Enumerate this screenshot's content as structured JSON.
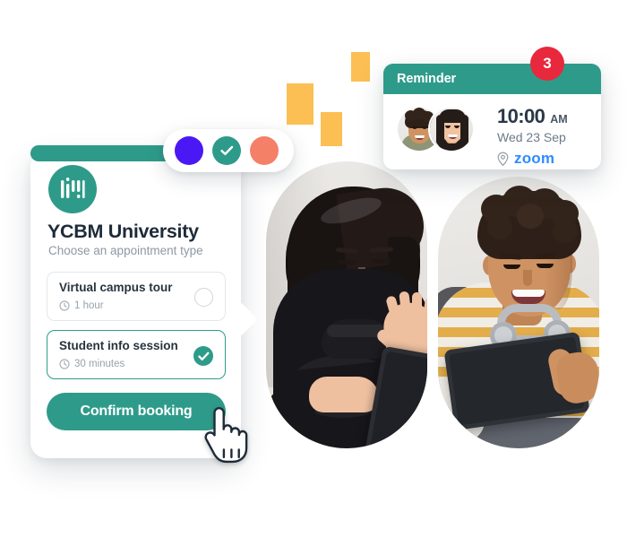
{
  "booking_card": {
    "brand_logo_icon": "ycbm-bars-logo-icon",
    "title": "YCBM University",
    "subtitle": "Choose an appointment type",
    "options": [
      {
        "name": "Virtual campus tour",
        "duration": "1 hour",
        "duration_icon": "clock-icon",
        "selected": false,
        "control_icon": "radio-empty-icon"
      },
      {
        "name": "Student info session",
        "duration": "30 minutes",
        "duration_icon": "clock-icon",
        "selected": true,
        "control_icon": "check-circle-icon"
      }
    ],
    "confirm_label": "Confirm booking",
    "accent_color": "#2E9B8A"
  },
  "color_picker": {
    "swatches": [
      {
        "name": "purple",
        "color": "#4A18F5",
        "selected": false
      },
      {
        "name": "teal",
        "color": "#2E9B8A",
        "selected": true,
        "icon": "check-icon"
      },
      {
        "name": "coral",
        "color": "#F58068",
        "selected": false
      }
    ]
  },
  "reminder_card": {
    "header_title": "Reminder",
    "header_color": "#2E9B8A",
    "attendees": [
      {
        "name": "attendee-1",
        "avatar_icon": "avatar-man"
      },
      {
        "name": "attendee-2",
        "avatar_icon": "avatar-woman"
      }
    ],
    "time": "10:00",
    "meridiem": "AM",
    "date": "Wed 23 Sep",
    "location_icon": "map-pin-icon",
    "location": "zoom",
    "location_color": "#2D8CFF",
    "badge_count": "3",
    "badge_color": "#E8283C"
  },
  "photos": [
    {
      "name": "woman-waving-at-tablet"
    },
    {
      "name": "man-with-headphones-holding-tablet"
    }
  ],
  "decorations": {
    "sparkles": [
      {
        "name": "sparkle-large",
        "color": "#FBBF54"
      },
      {
        "name": "sparkle-small",
        "color": "#FBBF54"
      },
      {
        "name": "sparkle-mid",
        "color": "#FBBF54"
      }
    ],
    "cursor_icon": "pointing-hand-cursor-icon"
  }
}
